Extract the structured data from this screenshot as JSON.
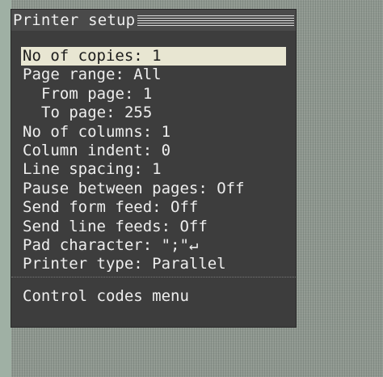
{
  "dialog": {
    "title": "Printer setup"
  },
  "menu": {
    "items": [
      {
        "label": "No of copies: 1",
        "selected": true,
        "indent": false
      },
      {
        "label": "Page range: All",
        "selected": false,
        "indent": false
      },
      {
        "label": "From page: 1",
        "selected": false,
        "indent": true
      },
      {
        "label": "To page: 255",
        "selected": false,
        "indent": true
      },
      {
        "label": "No of columns: 1",
        "selected": false,
        "indent": false
      },
      {
        "label": "Column indent: 0",
        "selected": false,
        "indent": false
      },
      {
        "label": "Line spacing: 1",
        "selected": false,
        "indent": false
      },
      {
        "label": "Pause between pages: Off",
        "selected": false,
        "indent": false
      },
      {
        "label": "Send form feed: Off",
        "selected": false,
        "indent": false
      },
      {
        "label": "Send line feeds: Off",
        "selected": false,
        "indent": false
      },
      {
        "label": "Pad character: \";\"↵",
        "selected": false,
        "indent": false
      },
      {
        "label": "Printer type: Parallel",
        "selected": false,
        "indent": false
      }
    ],
    "control_codes_label": "Control codes menu"
  },
  "colors": {
    "dialog_background": "#3d3d3d",
    "text": "#eeeeee",
    "highlight_background": "#e8e6d2",
    "highlight_text": "#1c1c1c",
    "desktop_background": "#8f9890"
  }
}
